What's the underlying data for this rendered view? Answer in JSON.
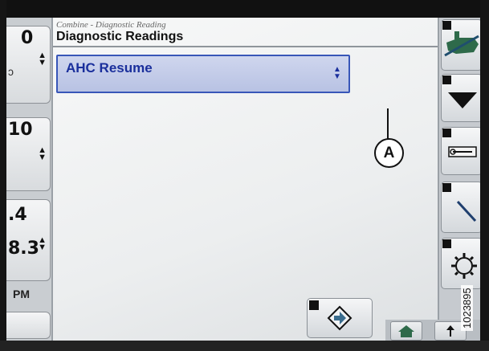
{
  "breadcrumb": "Combine - Diagnostic Reading",
  "page_title": "Diagnostic Readings",
  "dropdown": {
    "selected": "AHC Resume"
  },
  "callout_label": "A",
  "left_readouts": {
    "r1_value": "0",
    "r2_value": "10",
    "r3_value_top": ".4",
    "r3_value_bottom": "8.3",
    "time_suffix": "PM"
  },
  "figure_id": "1023895",
  "colors": {
    "accent": "#3856b8",
    "dropdown_bg": "#c3cce9",
    "panel_bg": "#eef0f1"
  }
}
